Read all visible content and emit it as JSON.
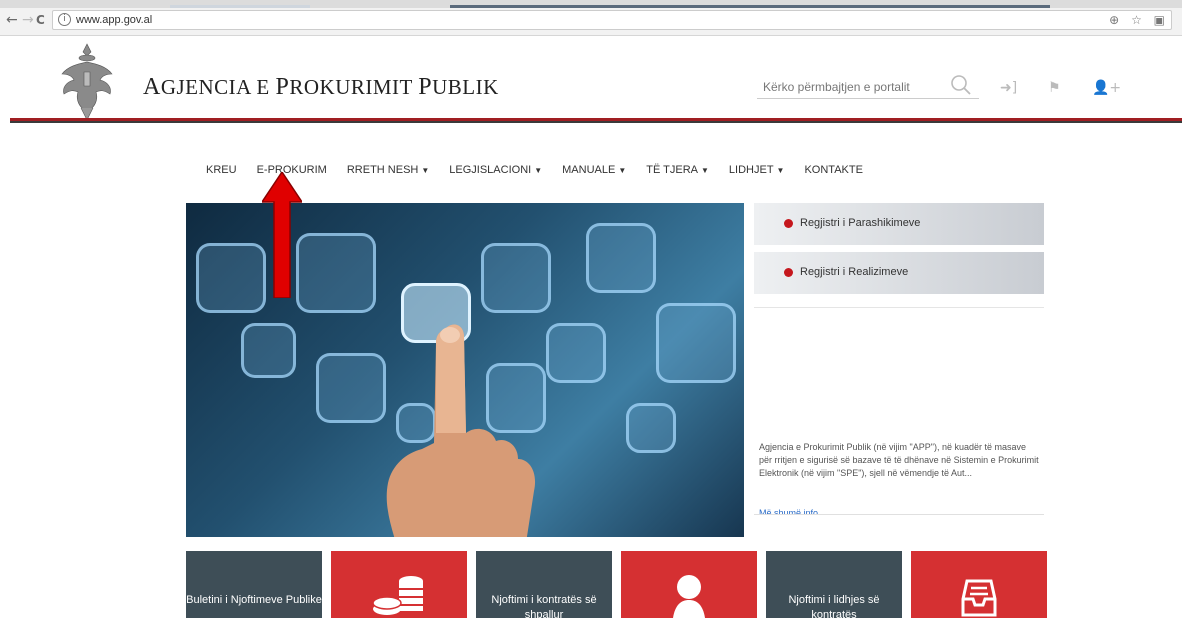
{
  "browser": {
    "back": "←",
    "forward": "→",
    "reload": "C",
    "info": "i",
    "url": "www.app.gov.al",
    "translate": "⊕",
    "star": "☆",
    "ext": "▣"
  },
  "header": {
    "brand_first": "A",
    "brand_rest": "GJENCIA E ",
    "brand_p1": "P",
    "brand_w2": "ROKURIMIT ",
    "brand_p2": "P",
    "brand_w3": "UBLIK",
    "search_placeholder": "Kërko përmbajtjen e portalit",
    "login": "➜]",
    "flag": "⚑",
    "adduser": "👤+"
  },
  "menu": [
    {
      "label": "KREU",
      "caret": ""
    },
    {
      "label": "E-PROKURIM",
      "caret": ""
    },
    {
      "label": "RRETH NESH",
      "caret": "▼"
    },
    {
      "label": "LEGJISLACIONI",
      "caret": "▼"
    },
    {
      "label": "MANUALE",
      "caret": "▼"
    },
    {
      "label": "TË TJERA",
      "caret": "▼"
    },
    {
      "label": "LIDHJET",
      "caret": "▼"
    },
    {
      "label": "KONTAKTE",
      "caret": ""
    }
  ],
  "sidebar": {
    "btn1": "Regjistri i Parashikimeve",
    "btn2": "Regjistri i Realizimeve",
    "text": "Agjencia e Prokurimit Publik (në vijim \"APP\"), në kuadër të masave për rritjen e sigurisë së bazave të të dhënave në Sistemin e Prokurimit Elektronik (në vijim \"SPE\"), sjell në vëmendje të Aut...",
    "more": "Më shumë info"
  },
  "tiles": [
    {
      "label": "Buletini i Njoftimeve Publike",
      "color": "dark"
    },
    {
      "label": "",
      "color": "red",
      "icon": "coins-icon"
    },
    {
      "label": "Njoftimi i kontratës së shpallur",
      "color": "dark"
    },
    {
      "label": "",
      "color": "red",
      "icon": "person-icon"
    },
    {
      "label": "Njoftimi i lidhjes së kontratës",
      "color": "dark"
    },
    {
      "label": "",
      "color": "red",
      "icon": "archive-icon"
    }
  ],
  "colors": {
    "accent_red": "#c5171d",
    "tile_dark": "#3e4e57",
    "tile_red": "#d53032",
    "header_line": "#a01e22"
  }
}
